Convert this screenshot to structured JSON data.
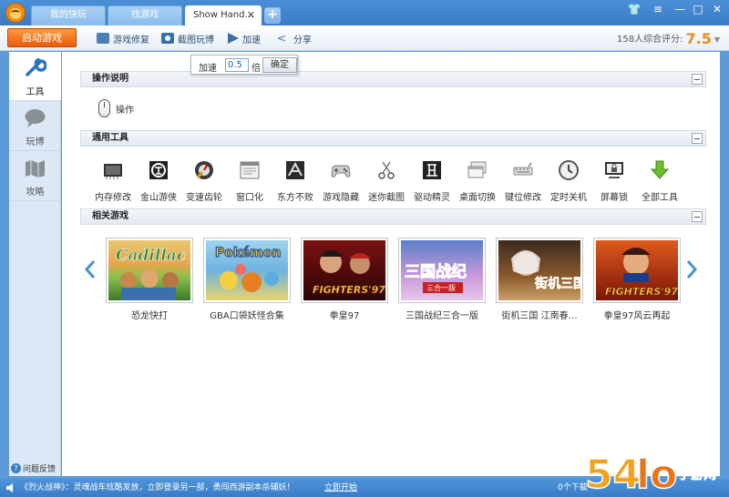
{
  "window": {
    "tabs": [
      {
        "label": "我的快玩"
      },
      {
        "label": "找游戏"
      },
      {
        "label": "Show Hand…",
        "close": "✕"
      }
    ],
    "add_tab": "+",
    "controls": {
      "skin": "👕",
      "menu": "≡",
      "min": "—",
      "max": "□",
      "close": "✕"
    }
  },
  "toolbar": {
    "start_label": "启动游戏",
    "buttons": [
      {
        "label": "游戏修复",
        "icon": "fix-icon"
      },
      {
        "label": "截图玩博",
        "icon": "camera-icon"
      },
      {
        "label": "加速",
        "icon": "speed-icon"
      },
      {
        "label": "分享",
        "icon": "share-icon"
      }
    ],
    "rating_label": "158人综合评分:",
    "rating_value": "7.5",
    "rating_arrow": "▼"
  },
  "speed_popup": {
    "prefix": "加速",
    "value": "0.5",
    "suffix": "倍",
    "ok_label": "确定"
  },
  "sidebar": {
    "items": [
      {
        "label": "工具",
        "icon": "wrench-icon",
        "active": true
      },
      {
        "label": "玩博",
        "icon": "chat-bubble-icon",
        "active": false
      },
      {
        "label": "攻略",
        "icon": "map-icon",
        "active": false
      }
    ],
    "feedback_icon": "?",
    "feedback": "问题反馈"
  },
  "sections": {
    "operation": {
      "title": "操作说明",
      "item_label": "操作"
    },
    "tools": {
      "title": "通用工具",
      "items": [
        {
          "label": "内存修改",
          "icon": "memory-chip-icon"
        },
        {
          "label": "金山游侠",
          "icon": "kingsoft-icon"
        },
        {
          "label": "变速齿轮",
          "icon": "gear-icon"
        },
        {
          "label": "窗口化",
          "icon": "window-icon"
        },
        {
          "label": "东方不败",
          "icon": "dongfang-icon"
        },
        {
          "label": "游戏隐藏",
          "icon": "gamepad-icon"
        },
        {
          "label": "迷你截图",
          "icon": "scissors-icon"
        },
        {
          "label": "驱动精灵",
          "icon": "driver-icon"
        },
        {
          "label": "桌面切换",
          "icon": "desktop-switch-icon"
        },
        {
          "label": "键位修改",
          "icon": "keyboard-icon"
        },
        {
          "label": "定时关机",
          "icon": "clock-icon"
        },
        {
          "label": "屏幕锁",
          "icon": "screen-lock-icon"
        },
        {
          "label": "全部工具",
          "icon": "download-arrow-icon"
        }
      ]
    },
    "games": {
      "title": "相关游戏",
      "items": [
        {
          "label": "恐龙快打"
        },
        {
          "label": "GBA口袋妖怪合集"
        },
        {
          "label": "拳皇97"
        },
        {
          "label": "三国战纪三合一版"
        },
        {
          "label": "街机三国  江南春…"
        },
        {
          "label": "拳皇97风云再起"
        }
      ]
    }
  },
  "statusbar": {
    "message": "《烈火战神》：灵魂战车炫酷发放，立即登录另一部，勇闯西游副本杀辅妖！",
    "link": "立即开始",
    "download": "0个下载"
  },
  "colors": {
    "accent": "#3a7cc6",
    "start": "#ea5b0c",
    "rating": "#f08a17"
  }
}
